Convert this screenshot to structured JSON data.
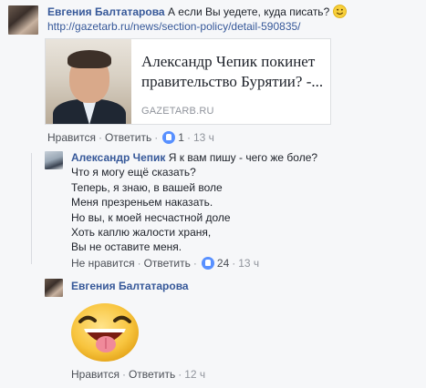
{
  "comment1": {
    "author": "Евгения Балтатарова",
    "text": "А если Вы уедете, куда писать?",
    "emoji_icon": "smile-emoji-icon",
    "link_url": "http://gazetarb.ru/news/section-policy/detail-590835/",
    "preview": {
      "title_line1": "Александр Чепик покинет",
      "title_line2": "правительство Бурятии? -...",
      "domain": "GAZETARB.RU"
    },
    "actions": {
      "like": "Нравится",
      "reply": "Ответить",
      "like_count": "1",
      "time": "13 ч"
    }
  },
  "reply": {
    "author": "Александр Чепик",
    "first_line": "Я к вам пишу - чего же боле?",
    "lines": [
      "Что я могу ещё сказать?",
      "Теперь, я знаю, в вашей воле",
      "Меня презреньем наказать.",
      "Но вы, к моей несчастной доле",
      "Хоть каплю жалости храня,",
      "Вы не оставите меня."
    ],
    "actions": {
      "unlike": "Не нравится",
      "reply": "Ответить",
      "like_count": "24",
      "time": "13 ч"
    }
  },
  "comment2": {
    "author": "Евгения Балтатарова",
    "sticker": "tongue-out-sticker",
    "actions": {
      "like": "Нравится",
      "reply": "Ответить",
      "time": "12 ч"
    }
  },
  "colors": {
    "name": "#365899",
    "like_badge": "#5890ff",
    "meta": "#90949c",
    "background": "#f6f7f9"
  }
}
